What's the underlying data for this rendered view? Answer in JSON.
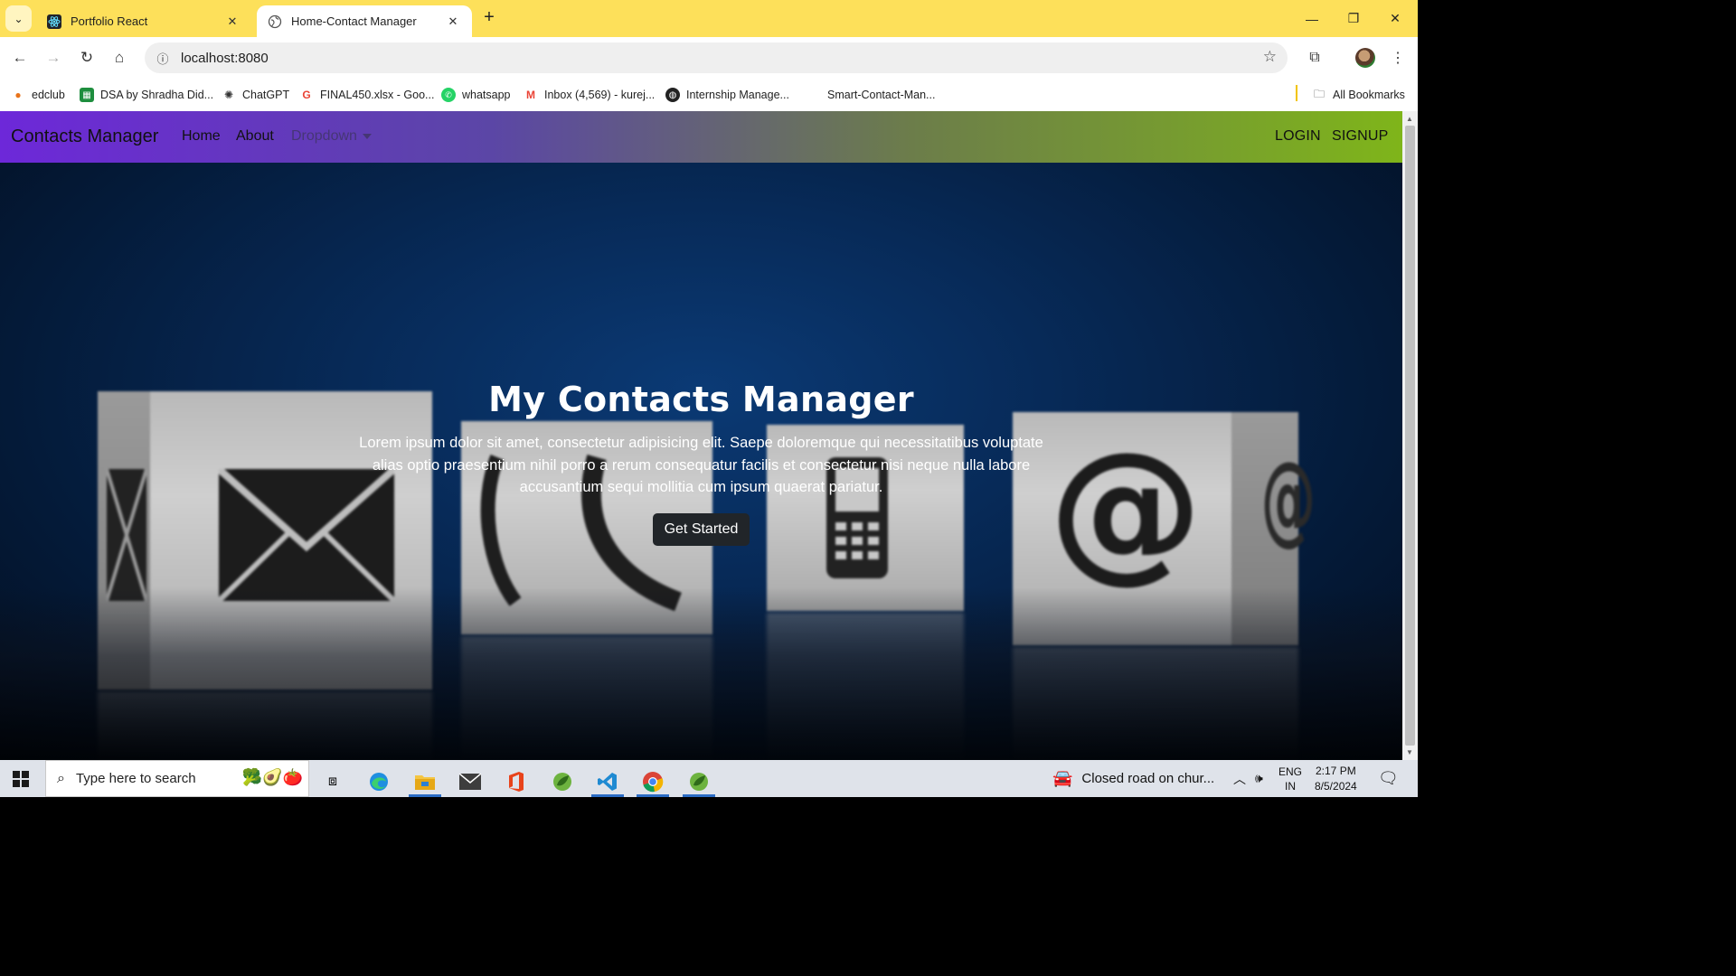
{
  "browser": {
    "tabs": [
      {
        "title": "Portfolio React",
        "icon": "react-icon",
        "active": false
      },
      {
        "title": "Home-Contact Manager",
        "icon": "globe-icon",
        "active": true
      }
    ],
    "address": "localhost:8080",
    "bookmarks": [
      {
        "label": "edclub",
        "icon": "edclub-icon"
      },
      {
        "label": "DSA by Shradha Did...",
        "icon": "sheets-icon"
      },
      {
        "label": "ChatGPT",
        "icon": "chatgpt-icon"
      },
      {
        "label": "FINAL450.xlsx - Goo...",
        "icon": "google-icon"
      },
      {
        "label": "whatsapp",
        "icon": "whatsapp-icon"
      },
      {
        "label": "Inbox (4,569) - kurej...",
        "icon": "gmail-icon"
      },
      {
        "label": "Internship Manage...",
        "icon": "globe-icon"
      },
      {
        "label": "Smart-Contact-Man...",
        "icon": ""
      }
    ],
    "all_bookmarks": "All Bookmarks"
  },
  "site": {
    "brand": "Contacts Manager",
    "nav": {
      "home": "Home",
      "about": "About",
      "dropdown": "Dropdown"
    },
    "auth": {
      "login": "LOGIN",
      "signup": "SIGNUP"
    },
    "hero": {
      "title": "My Contacts Manager",
      "text": "Lorem ipsum dolor sit amet, consectetur adipisicing elit. Saepe doloremque qui necessitatibus voluptate alias optio praesentium nihil porro a rerum consequatur facilis et consectetur nisi neque nulla labore accusantium sequi mollitia cum ipsum quaerat pariatur.",
      "cta": "Get Started"
    },
    "colors": {
      "nav_start": "#6d28d9",
      "nav_end": "#7fb51a",
      "hero_bg": "#072a58",
      "cta_bg": "#212529"
    }
  },
  "taskbar": {
    "search_placeholder": "Type here to search",
    "news": "Closed road on chur...",
    "lang": "ENG",
    "region": "IN",
    "time": "2:17 PM",
    "date": "8/5/2024"
  }
}
